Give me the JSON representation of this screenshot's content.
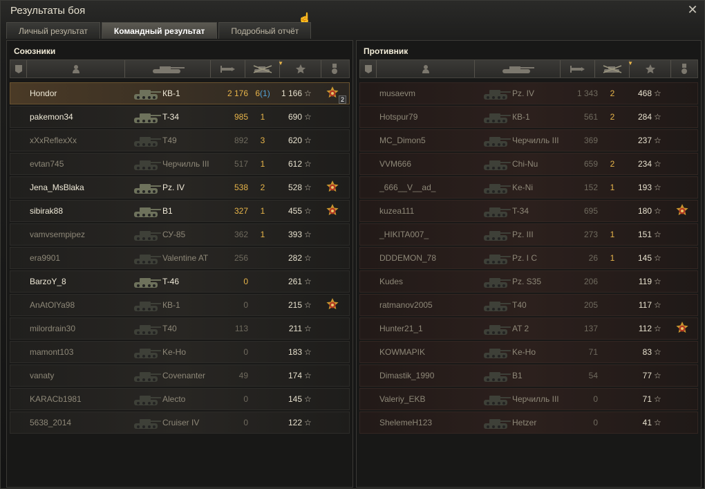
{
  "window": {
    "title": "Результаты боя",
    "close_glyph": "✕"
  },
  "tabs": [
    {
      "label": "Личный результат",
      "active": false
    },
    {
      "label": "Командный результат",
      "active": true
    },
    {
      "label": "Подробный отчёт",
      "active": false
    }
  ],
  "colors": {
    "accent": "#e8b54a",
    "alive_text": "#f0ead8",
    "dead_text": "#8e8878",
    "kills_blue": "#53a2d6"
  },
  "columns": [
    "rank-icon",
    "player-icon",
    "tank-icon",
    "damage-icon",
    "kills-icon",
    "xp-star-icon",
    "medal-icon"
  ],
  "allies": {
    "title": "Союзники",
    "rows": [
      {
        "name": "Hondor",
        "tank": "КВ-1",
        "damage": "2 176",
        "kills": "6",
        "kills_extra": "1",
        "xp": "1 166",
        "medal": "order-medal-2",
        "alive": true,
        "highlight": true
      },
      {
        "name": "pakemon34",
        "tank": "T-34",
        "damage": "985",
        "kills": "1",
        "kills_extra": "",
        "xp": "690",
        "medal": "",
        "alive": true,
        "highlight": false
      },
      {
        "name": "xXxReflexXx",
        "tank": "T49",
        "damage": "892",
        "kills": "3",
        "kills_extra": "",
        "xp": "620",
        "medal": "",
        "alive": false,
        "highlight": false
      },
      {
        "name": "evtan745",
        "tank": "Черчилль III",
        "damage": "517",
        "kills": "1",
        "kills_extra": "",
        "xp": "612",
        "medal": "",
        "alive": false,
        "highlight": false
      },
      {
        "name": "Jena_MsBlaka",
        "tank": "Pz. IV",
        "damage": "538",
        "kills": "2",
        "kills_extra": "",
        "xp": "528",
        "medal": "order-medal",
        "alive": true,
        "highlight": false
      },
      {
        "name": "sibirak88",
        "tank": "B1",
        "damage": "327",
        "kills": "1",
        "kills_extra": "",
        "xp": "455",
        "medal": "order-medal",
        "alive": true,
        "highlight": false
      },
      {
        "name": "vamvsempipez",
        "tank": "СУ-85",
        "damage": "362",
        "kills": "1",
        "kills_extra": "",
        "xp": "393",
        "medal": "",
        "alive": false,
        "highlight": false
      },
      {
        "name": "era9901",
        "tank": "Valentine AT",
        "damage": "256",
        "kills": "",
        "kills_extra": "",
        "xp": "282",
        "medal": "",
        "alive": false,
        "highlight": false
      },
      {
        "name": "BarzoY_8",
        "tank": "T-46",
        "damage": "0",
        "kills": "",
        "kills_extra": "",
        "xp": "261",
        "medal": "",
        "alive": true,
        "highlight": false
      },
      {
        "name": "AnAtOlYa98",
        "tank": "КВ-1",
        "damage": "0",
        "kills": "",
        "kills_extra": "",
        "xp": "215",
        "medal": "order-medal",
        "alive": false,
        "highlight": false
      },
      {
        "name": "milordrain30",
        "tank": "T40",
        "damage": "113",
        "kills": "",
        "kills_extra": "",
        "xp": "211",
        "medal": "",
        "alive": false,
        "highlight": false
      },
      {
        "name": "mamont103",
        "tank": "Ke-Ho",
        "damage": "0",
        "kills": "",
        "kills_extra": "",
        "xp": "183",
        "medal": "",
        "alive": false,
        "highlight": false
      },
      {
        "name": "vanaty",
        "tank": "Covenanter",
        "damage": "49",
        "kills": "",
        "kills_extra": "",
        "xp": "174",
        "medal": "",
        "alive": false,
        "highlight": false
      },
      {
        "name": "KARACb1981",
        "tank": "Alecto",
        "damage": "0",
        "kills": "",
        "kills_extra": "",
        "xp": "145",
        "medal": "",
        "alive": false,
        "highlight": false
      },
      {
        "name": "5638_2014",
        "tank": "Cruiser IV",
        "damage": "0",
        "kills": "",
        "kills_extra": "",
        "xp": "122",
        "medal": "",
        "alive": false,
        "highlight": false
      }
    ]
  },
  "enemies": {
    "title": "Противник",
    "rows": [
      {
        "name": "musaevm",
        "tank": "Pz. IV",
        "damage": "1 343",
        "kills": "2",
        "kills_extra": "",
        "xp": "468",
        "medal": "",
        "alive": false
      },
      {
        "name": "Hotspur79",
        "tank": "КВ-1",
        "damage": "561",
        "kills": "2",
        "kills_extra": "",
        "xp": "284",
        "medal": "",
        "alive": false
      },
      {
        "name": "MC_Dimon5",
        "tank": "Черчилль III",
        "damage": "369",
        "kills": "",
        "kills_extra": "",
        "xp": "237",
        "medal": "",
        "alive": false
      },
      {
        "name": "VVM666",
        "tank": "Chi-Nu",
        "damage": "659",
        "kills": "2",
        "kills_extra": "",
        "xp": "234",
        "medal": "",
        "alive": false
      },
      {
        "name": "_666__V__ad_",
        "tank": "Ke-Ni",
        "damage": "152",
        "kills": "1",
        "kills_extra": "",
        "xp": "193",
        "medal": "",
        "alive": false
      },
      {
        "name": "kuzea111",
        "tank": "T-34",
        "damage": "695",
        "kills": "",
        "kills_extra": "",
        "xp": "180",
        "medal": "order-medal",
        "alive": false
      },
      {
        "name": "_HIKITA007_",
        "tank": "Pz. III",
        "damage": "273",
        "kills": "1",
        "kills_extra": "",
        "xp": "151",
        "medal": "",
        "alive": false
      },
      {
        "name": "DDDEMON_78",
        "tank": "Pz. I C",
        "damage": "26",
        "kills": "1",
        "kills_extra": "",
        "xp": "145",
        "medal": "",
        "alive": false
      },
      {
        "name": "Kudes",
        "tank": "Pz. S35",
        "damage": "206",
        "kills": "",
        "kills_extra": "",
        "xp": "119",
        "medal": "",
        "alive": false
      },
      {
        "name": "ratmanov2005",
        "tank": "T40",
        "damage": "205",
        "kills": "",
        "kills_extra": "",
        "xp": "117",
        "medal": "",
        "alive": false
      },
      {
        "name": "Hunter21_1",
        "tank": "AT 2",
        "damage": "137",
        "kills": "",
        "kills_extra": "",
        "xp": "112",
        "medal": "order-medal",
        "alive": false
      },
      {
        "name": "KOWMAPIK",
        "tank": "Ke-Ho",
        "damage": "71",
        "kills": "",
        "kills_extra": "",
        "xp": "83",
        "medal": "",
        "alive": false
      },
      {
        "name": "Dimastik_1990",
        "tank": "B1",
        "damage": "54",
        "kills": "",
        "kills_extra": "",
        "xp": "77",
        "medal": "",
        "alive": false
      },
      {
        "name": "Valeriy_EKB",
        "tank": "Черчилль III",
        "damage": "0",
        "kills": "",
        "kills_extra": "",
        "xp": "71",
        "medal": "",
        "alive": false
      },
      {
        "name": "ShelemeH123",
        "tank": "Hetzer",
        "damage": "0",
        "kills": "",
        "kills_extra": "",
        "xp": "41",
        "medal": "",
        "alive": false
      }
    ]
  },
  "medal_badge_count": "2",
  "star_glyph": "☆"
}
